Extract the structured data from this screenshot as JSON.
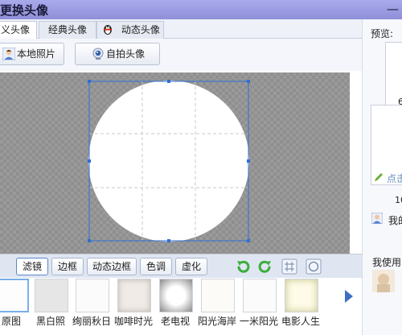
{
  "window": {
    "title": "更换头像",
    "minimize": "—"
  },
  "tabs": [
    {
      "label": "义头像"
    },
    {
      "label": "经典头像"
    },
    {
      "label": "动态头像"
    }
  ],
  "actions": {
    "local_photo": "本地照片",
    "selfie": "自拍头像"
  },
  "filter_tabs": [
    {
      "label": "滤镜"
    },
    {
      "label": "边框"
    },
    {
      "label": "动态边框"
    },
    {
      "label": "色调"
    },
    {
      "label": "虚化"
    }
  ],
  "filters": [
    {
      "label": "原图"
    },
    {
      "label": "黑白照"
    },
    {
      "label": "绚丽秋日"
    },
    {
      "label": "咖啡时光"
    },
    {
      "label": "老电视"
    },
    {
      "label": "阳光海岸"
    },
    {
      "label": "一米阳光"
    },
    {
      "label": "电影人生"
    }
  ],
  "right_panel": {
    "preview_label": "预览:",
    "size_large": "6",
    "click_label": "点击",
    "size_mid": "10",
    "my_label": "我的",
    "used_label": "我使用"
  },
  "colors": {
    "accent": "#7aaee8",
    "titlebar": "#9a9ae0",
    "crop_handle": "#2f6fd6",
    "rotate_green": "#3cae3c"
  }
}
